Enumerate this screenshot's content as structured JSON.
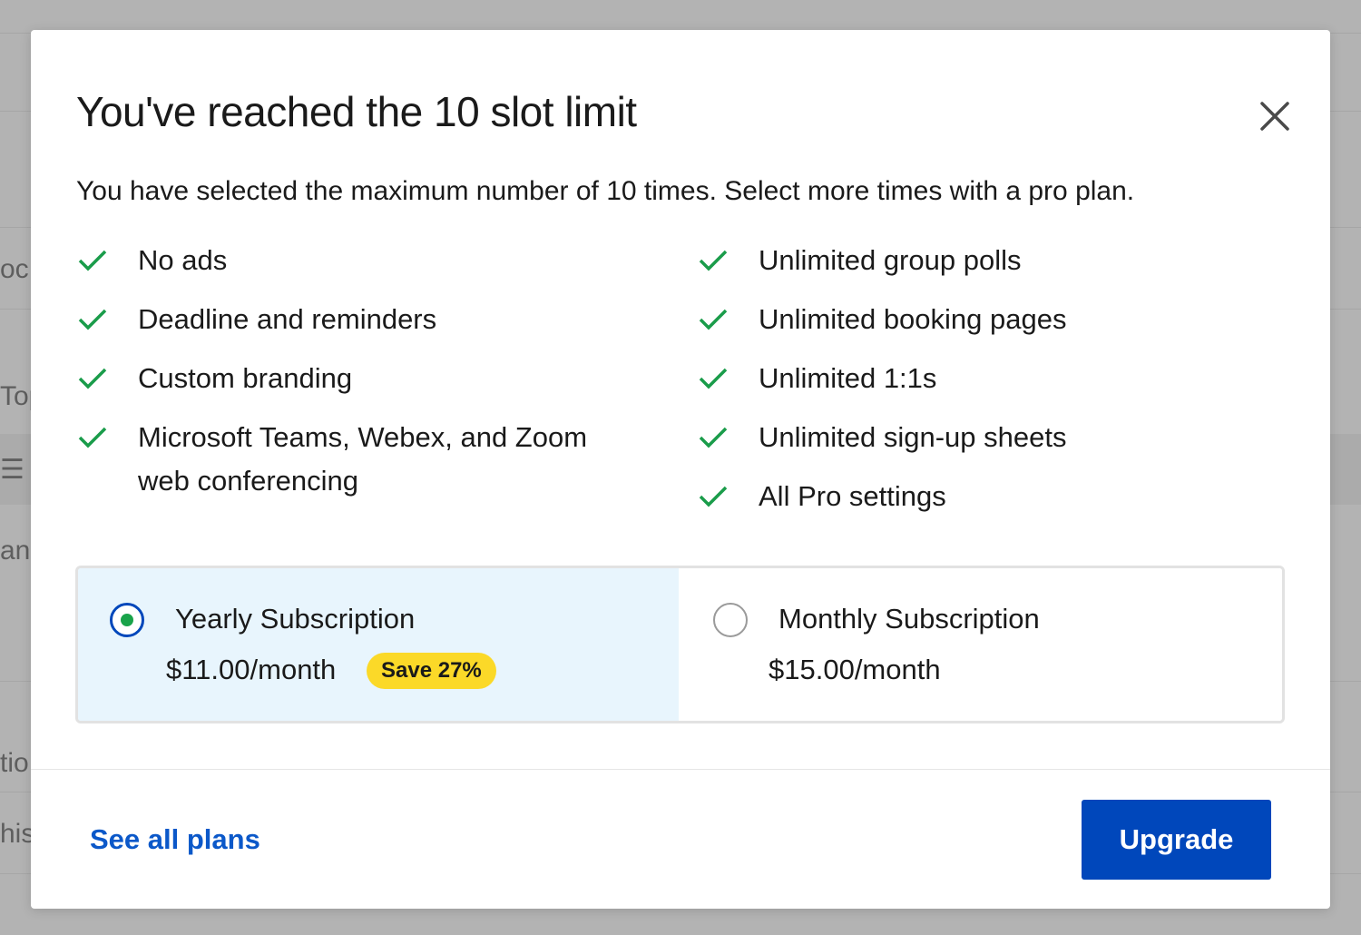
{
  "background": {
    "fragments": [
      "oc",
      "Top",
      "☰",
      "an",
      "tio",
      "his"
    ]
  },
  "modal": {
    "title": "You've reached the 10 slot limit",
    "subtitle": "You have selected the maximum number of 10 times. Select more times with a pro plan.",
    "close_icon": "close-icon",
    "features_left": [
      "No ads",
      "Deadline and reminders",
      "Custom branding",
      "Microsoft Teams, Webex, and Zoom web conferencing"
    ],
    "features_right": [
      "Unlimited group polls",
      "Unlimited booking pages",
      "Unlimited 1:1s",
      "Unlimited sign-up sheets",
      "All Pro settings"
    ],
    "plans": {
      "yearly": {
        "name": "Yearly Subscription",
        "price": "$11.00/month",
        "badge": "Save 27%",
        "selected": true
      },
      "monthly": {
        "name": "Monthly Subscription",
        "price": "$15.00/month",
        "selected": false
      }
    },
    "footer": {
      "see_all_plans": "See all plans",
      "upgrade": "Upgrade"
    }
  },
  "colors": {
    "primary": "#0047bb",
    "link": "#0b58c9",
    "check": "#1a9c4a",
    "selected_bg": "#e8f5fd",
    "badge": "#fbd928",
    "overlay": "#b3b3b3"
  }
}
